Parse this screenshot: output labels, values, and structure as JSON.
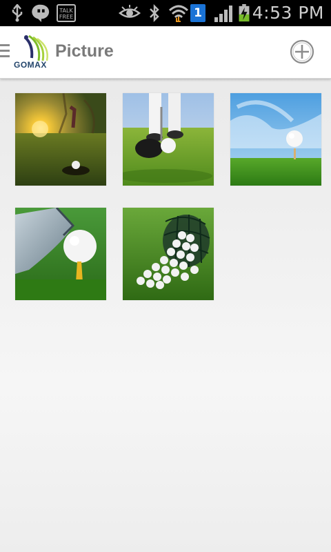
{
  "status_bar": {
    "time": "4:53 PM",
    "talk_icon_text": "TALK FREE",
    "sim_slot": "1",
    "icons": [
      "usb-icon",
      "hangouts-icon",
      "talk-free-icon",
      "eye-icon",
      "bluetooth-icon",
      "wifi-icon",
      "sim-icon",
      "signal-icon",
      "battery-icon"
    ]
  },
  "app_bar": {
    "logo_text": "GOMAX",
    "title": "Picture",
    "menu_icon": "hamburger-icon",
    "add_icon": "add-circle-icon"
  },
  "pictures": [
    {
      "subject": "golf-sunset-hole"
    },
    {
      "subject": "golf-putter-ball"
    },
    {
      "subject": "golf-ball-tee-sky"
    },
    {
      "subject": "golf-club-ball-tee"
    },
    {
      "subject": "golf-ball-basket"
    }
  ],
  "colors": {
    "status_bar_bg": "#000000",
    "app_bar_bg": "#ffffff",
    "title_text": "#7a7a7a",
    "logo_green": "#7dbb2a",
    "logo_blue": "#23456b"
  }
}
